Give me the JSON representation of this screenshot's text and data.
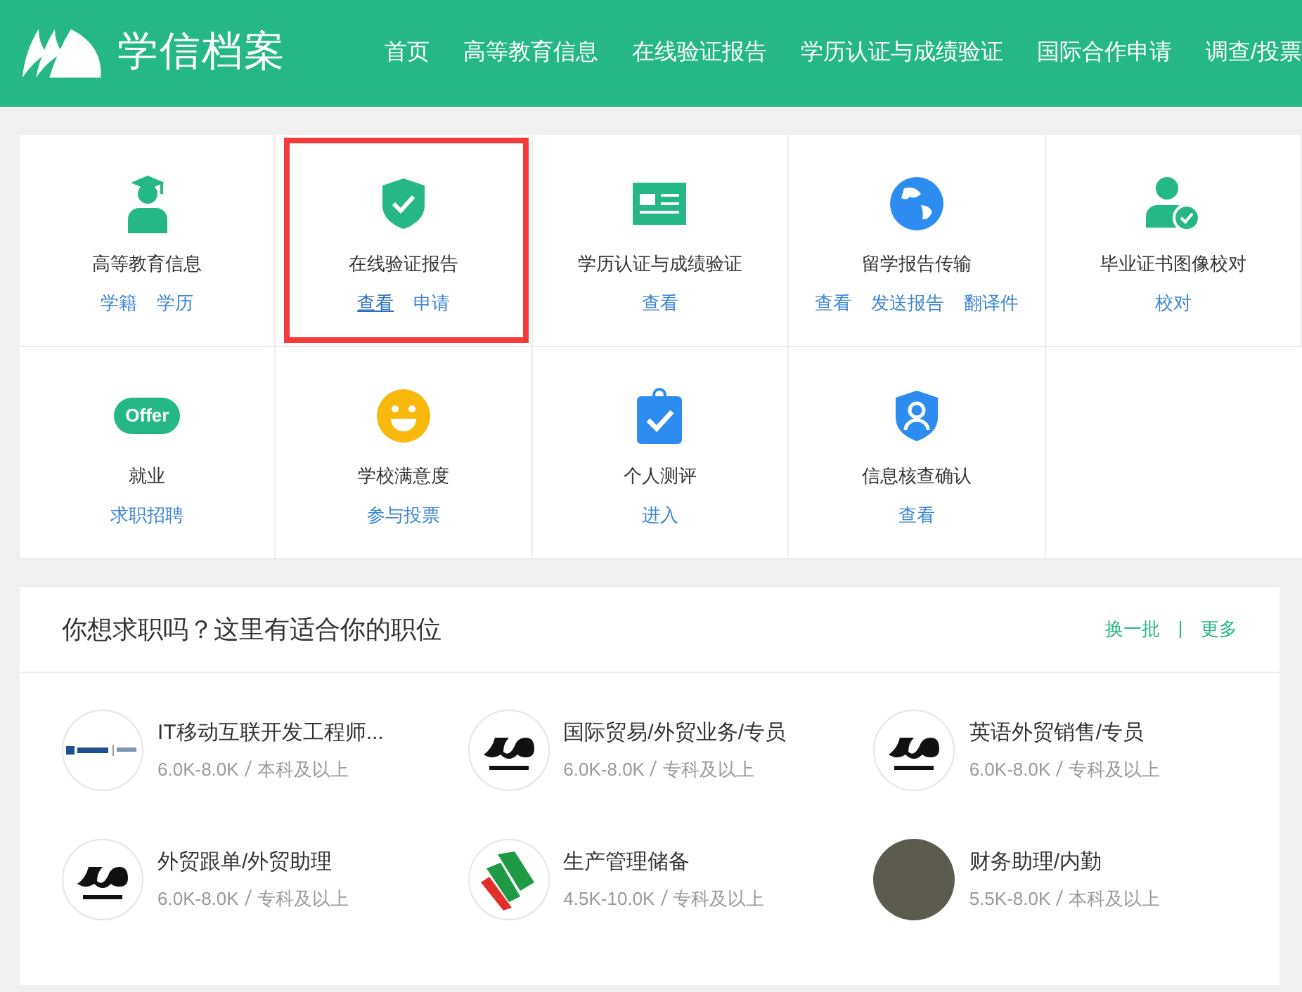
{
  "header": {
    "logo_text": "学信档案",
    "nav": [
      "首页",
      "高等教育信息",
      "在线验证报告",
      "学历认证与成绩验证",
      "国际合作申请",
      "调查/投票"
    ]
  },
  "services": [
    {
      "kind": "graduate",
      "title": "高等教育信息",
      "highlighted": false,
      "links": [
        {
          "label": "学籍",
          "hovered": false
        },
        {
          "label": "学历",
          "hovered": false
        }
      ]
    },
    {
      "kind": "shield-check",
      "title": "在线验证报告",
      "highlighted": true,
      "links": [
        {
          "label": "查看",
          "hovered": true
        },
        {
          "label": "申请",
          "hovered": false
        }
      ]
    },
    {
      "kind": "id-card",
      "title": "学历认证与成绩验证",
      "highlighted": false,
      "links": [
        {
          "label": "查看",
          "hovered": false
        }
      ]
    },
    {
      "kind": "globe",
      "title": "留学报告传输",
      "highlighted": false,
      "links": [
        {
          "label": "查看",
          "hovered": false
        },
        {
          "label": "发送报告",
          "hovered": false
        },
        {
          "label": "翻译件",
          "hovered": false
        }
      ]
    },
    {
      "kind": "person-check",
      "title": "毕业证书图像校对",
      "highlighted": false,
      "links": [
        {
          "label": "校对",
          "hovered": false
        }
      ]
    },
    {
      "kind": "offer",
      "title": "就业",
      "highlighted": false,
      "badge": "Offer",
      "links": [
        {
          "label": "求职招聘",
          "hovered": false
        }
      ]
    },
    {
      "kind": "smiley",
      "title": "学校满意度",
      "highlighted": false,
      "links": [
        {
          "label": "参与投票",
          "hovered": false
        }
      ]
    },
    {
      "kind": "clipboard",
      "title": "个人测评",
      "highlighted": false,
      "links": [
        {
          "label": "进入",
          "hovered": false
        }
      ]
    },
    {
      "kind": "shield-person",
      "title": "信息核查确认",
      "highlighted": false,
      "links": [
        {
          "label": "查看",
          "hovered": false
        }
      ]
    }
  ],
  "jobs": {
    "title": "你想求职吗？这里有适合你的职位",
    "actions": [
      "换一批",
      "更多"
    ],
    "items": [
      {
        "kind": "bank",
        "title": "IT移动互联开发工程师...",
        "salary": "6.0K-8.0K",
        "education": "本科及以上"
      },
      {
        "kind": "fudeng",
        "title": "国际贸易/外贸业务/专员",
        "salary": "6.0K-8.0K",
        "education": "专科及以上"
      },
      {
        "kind": "fudeng",
        "title": "英语外贸销售/专员",
        "salary": "6.0K-8.0K",
        "education": "专科及以上"
      },
      {
        "kind": "fudeng",
        "title": "外贸跟单/外贸助理",
        "salary": "6.0K-8.0K",
        "education": "专科及以上"
      },
      {
        "kind": "m",
        "title": "生产管理储备",
        "salary": "4.5K-10.0K",
        "education": "专科及以上"
      },
      {
        "kind": "photo",
        "title": "财务助理/内勤",
        "salary": "5.5K-8.0K",
        "education": "本科及以上"
      }
    ]
  }
}
